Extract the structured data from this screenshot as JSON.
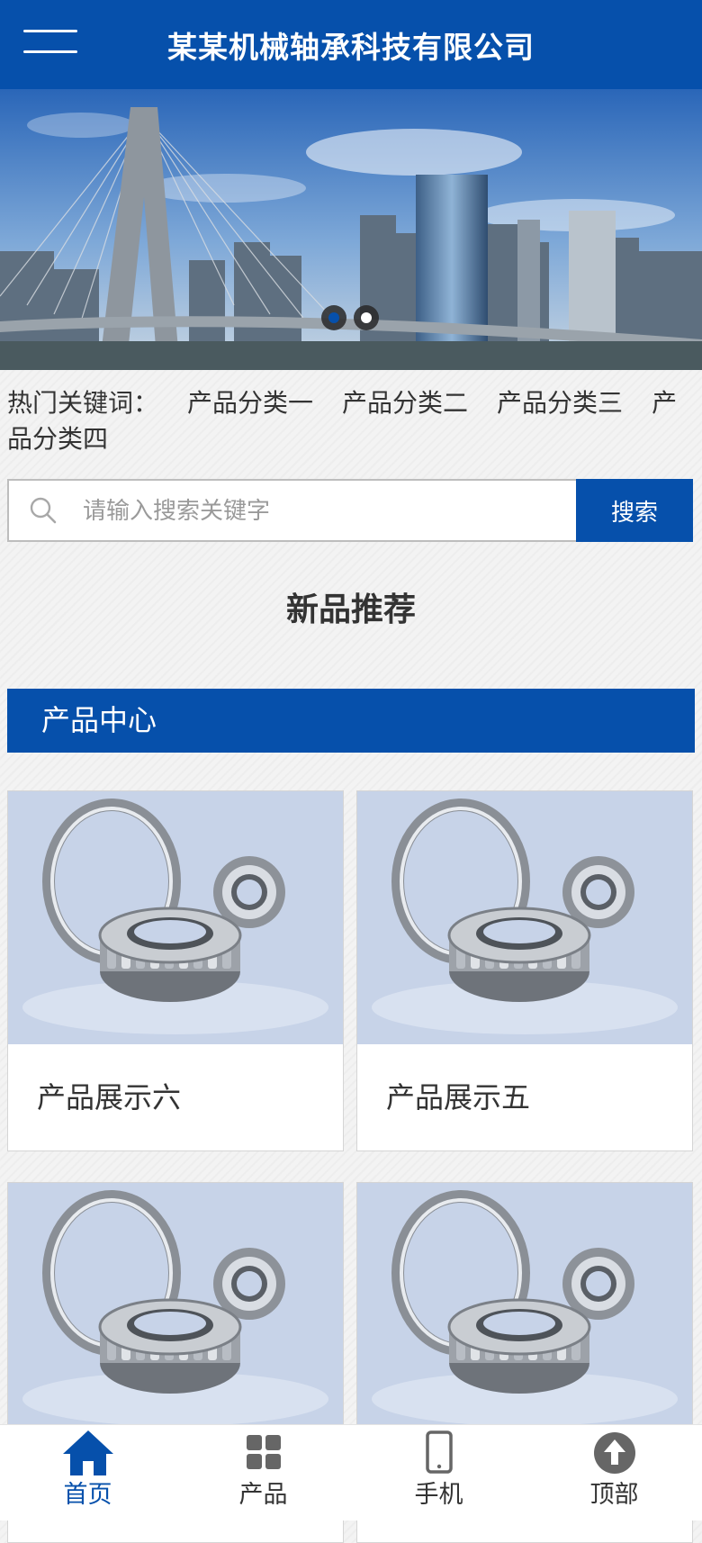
{
  "header": {
    "title": "某某机械轴承科技有限公司",
    "menu_icon": "hamburger-menu-icon"
  },
  "banner": {
    "slides_total": 2,
    "active_slide": 1
  },
  "keywords": {
    "label": "热门关键词：",
    "items": [
      "产品分类一",
      "产品分类二",
      "产品分类三",
      "产品分类四"
    ]
  },
  "search": {
    "placeholder": "请输入搜索关键字",
    "value": "",
    "button_label": "搜索",
    "icon": "search-icon"
  },
  "section": {
    "title": "新品推荐"
  },
  "category": {
    "label": "产品中心"
  },
  "products": [
    {
      "name": "产品展示六"
    },
    {
      "name": "产品展示五"
    },
    {
      "name": ""
    },
    {
      "name": ""
    }
  ],
  "nav": {
    "items": [
      {
        "label": "首页",
        "icon": "home-icon",
        "active": true
      },
      {
        "label": "产品",
        "icon": "grid-icon",
        "active": false
      },
      {
        "label": "手机",
        "icon": "phone-icon",
        "active": false
      },
      {
        "label": "顶部",
        "icon": "arrow-up-icon",
        "active": false
      }
    ]
  },
  "colors": {
    "brand": "#0650ab",
    "background": "#f3f3f3",
    "text": "#333333"
  }
}
